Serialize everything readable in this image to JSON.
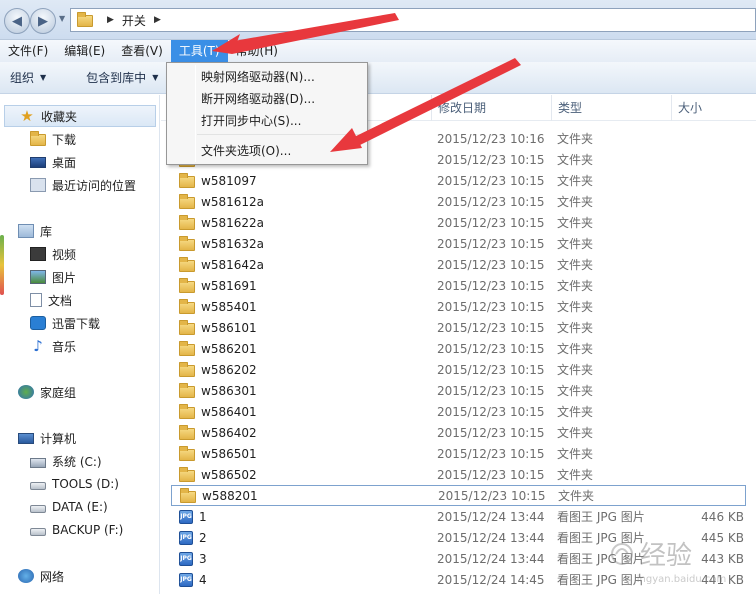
{
  "address": {
    "path_segments": [
      "开关"
    ]
  },
  "menubar": {
    "items": [
      {
        "label": "文件(F)",
        "name": "menu-file"
      },
      {
        "label": "编辑(E)",
        "name": "menu-edit"
      },
      {
        "label": "查看(V)",
        "name": "menu-view"
      },
      {
        "label": "工具(T)",
        "name": "menu-tools",
        "active": true
      },
      {
        "label": "帮助(H)",
        "name": "menu-help"
      }
    ]
  },
  "toolbar": {
    "organize_label": "组织",
    "include_label": "包含到库中"
  },
  "tools_menu": {
    "items": [
      "映射网络驱动器(N)...",
      "断开网络驱动器(D)...",
      "打开同步中心(S)...",
      "文件夹选项(O)..."
    ]
  },
  "sidebar": {
    "favorites": {
      "label": "收藏夹",
      "items": [
        "下载",
        "桌面",
        "最近访问的位置"
      ]
    },
    "libraries": {
      "label": "库",
      "items": [
        "视频",
        "图片",
        "文档",
        "迅雷下载",
        "音乐"
      ]
    },
    "homegroup": {
      "label": "家庭组"
    },
    "computer": {
      "label": "计算机",
      "items": [
        "系统 (C:)",
        "TOOLS (D:)",
        "DATA (E:)",
        "BACKUP (F:)"
      ]
    },
    "network": {
      "label": "网络"
    }
  },
  "columns": {
    "date": "修改日期",
    "type": "类型",
    "size": "大小"
  },
  "files": [
    {
      "name": "",
      "date": "2015/12/23 10:16",
      "type": "文件夹",
      "size": ""
    },
    {
      "name": "",
      "date": "2015/12/23 10:15",
      "type": "文件夹",
      "size": ""
    },
    {
      "name": "w581097",
      "date": "2015/12/23 10:15",
      "type": "文件夹",
      "size": ""
    },
    {
      "name": "w581612a",
      "date": "2015/12/23 10:15",
      "type": "文件夹",
      "size": ""
    },
    {
      "name": "w581622a",
      "date": "2015/12/23 10:15",
      "type": "文件夹",
      "size": ""
    },
    {
      "name": "w581632a",
      "date": "2015/12/23 10:15",
      "type": "文件夹",
      "size": ""
    },
    {
      "name": "w581642a",
      "date": "2015/12/23 10:15",
      "type": "文件夹",
      "size": ""
    },
    {
      "name": "w581691",
      "date": "2015/12/23 10:15",
      "type": "文件夹",
      "size": ""
    },
    {
      "name": "w585401",
      "date": "2015/12/23 10:15",
      "type": "文件夹",
      "size": ""
    },
    {
      "name": "w586101",
      "date": "2015/12/23 10:15",
      "type": "文件夹",
      "size": ""
    },
    {
      "name": "w586201",
      "date": "2015/12/23 10:15",
      "type": "文件夹",
      "size": ""
    },
    {
      "name": "w586202",
      "date": "2015/12/23 10:15",
      "type": "文件夹",
      "size": ""
    },
    {
      "name": "w586301",
      "date": "2015/12/23 10:15",
      "type": "文件夹",
      "size": ""
    },
    {
      "name": "w586401",
      "date": "2015/12/23 10:15",
      "type": "文件夹",
      "size": ""
    },
    {
      "name": "w586402",
      "date": "2015/12/23 10:15",
      "type": "文件夹",
      "size": ""
    },
    {
      "name": "w586501",
      "date": "2015/12/23 10:15",
      "type": "文件夹",
      "size": ""
    },
    {
      "name": "w586502",
      "date": "2015/12/23 10:15",
      "type": "文件夹",
      "size": ""
    },
    {
      "name": "w588201",
      "date": "2015/12/23 10:15",
      "type": "文件夹",
      "size": "",
      "selected": true
    },
    {
      "name": "1",
      "date": "2015/12/24 13:44",
      "type": "看图王 JPG 图片",
      "size": "446 KB",
      "icon": "jpg"
    },
    {
      "name": "2",
      "date": "2015/12/24 13:44",
      "type": "看图王 JPG 图片",
      "size": "445 KB",
      "icon": "jpg"
    },
    {
      "name": "3",
      "date": "2015/12/24 13:44",
      "type": "看图王 JPG 图片",
      "size": "443 KB",
      "icon": "jpg"
    },
    {
      "name": "4",
      "date": "2015/12/24 14:45",
      "type": "看图王 JPG 图片",
      "size": "441 KB",
      "icon": "jpg"
    }
  ],
  "jpg_icon_text": "JPG",
  "watermark": {
    "text": "经验",
    "sub": "jingyan.baidu.com"
  },
  "colors": {
    "menu_active": "#3a8fe6",
    "arrow": "#e8383d",
    "selection_border": "#7da2ce"
  }
}
